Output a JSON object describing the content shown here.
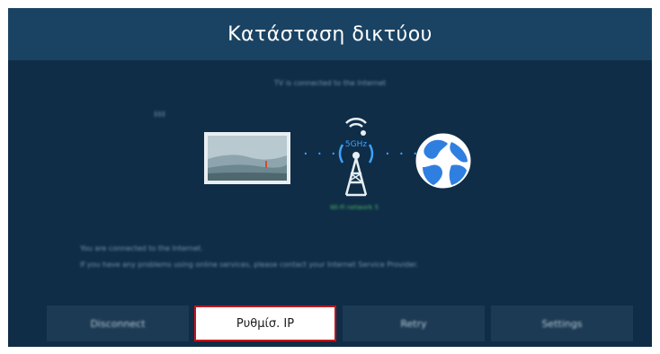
{
  "header": {
    "title": "Κατάσταση δικτύου"
  },
  "status": {
    "connected_line": "TV is connected to the Internet",
    "band": "Wi-Fi network 5"
  },
  "diagram": {
    "tower_label": "5GHz",
    "connector": "· · ·"
  },
  "message": {
    "line1": "You are connected to the Internet.",
    "line2": "If you have any problems using online services, please contact your Internet Service Provider."
  },
  "buttons": [
    {
      "label": "Disconnect"
    },
    {
      "label": "Ρυθμίσ. IP"
    },
    {
      "label": "Retry"
    },
    {
      "label": "Settings"
    }
  ],
  "colors": {
    "panel_bg": "#0f2d47",
    "titlebar_bg": "#1a4363",
    "accent_blue": "#3da2ff",
    "focus_border": "#c0161d",
    "band_green": "#56c26a"
  },
  "icons": [
    "tv-icon",
    "wifi-tower-icon",
    "globe-icon"
  ]
}
